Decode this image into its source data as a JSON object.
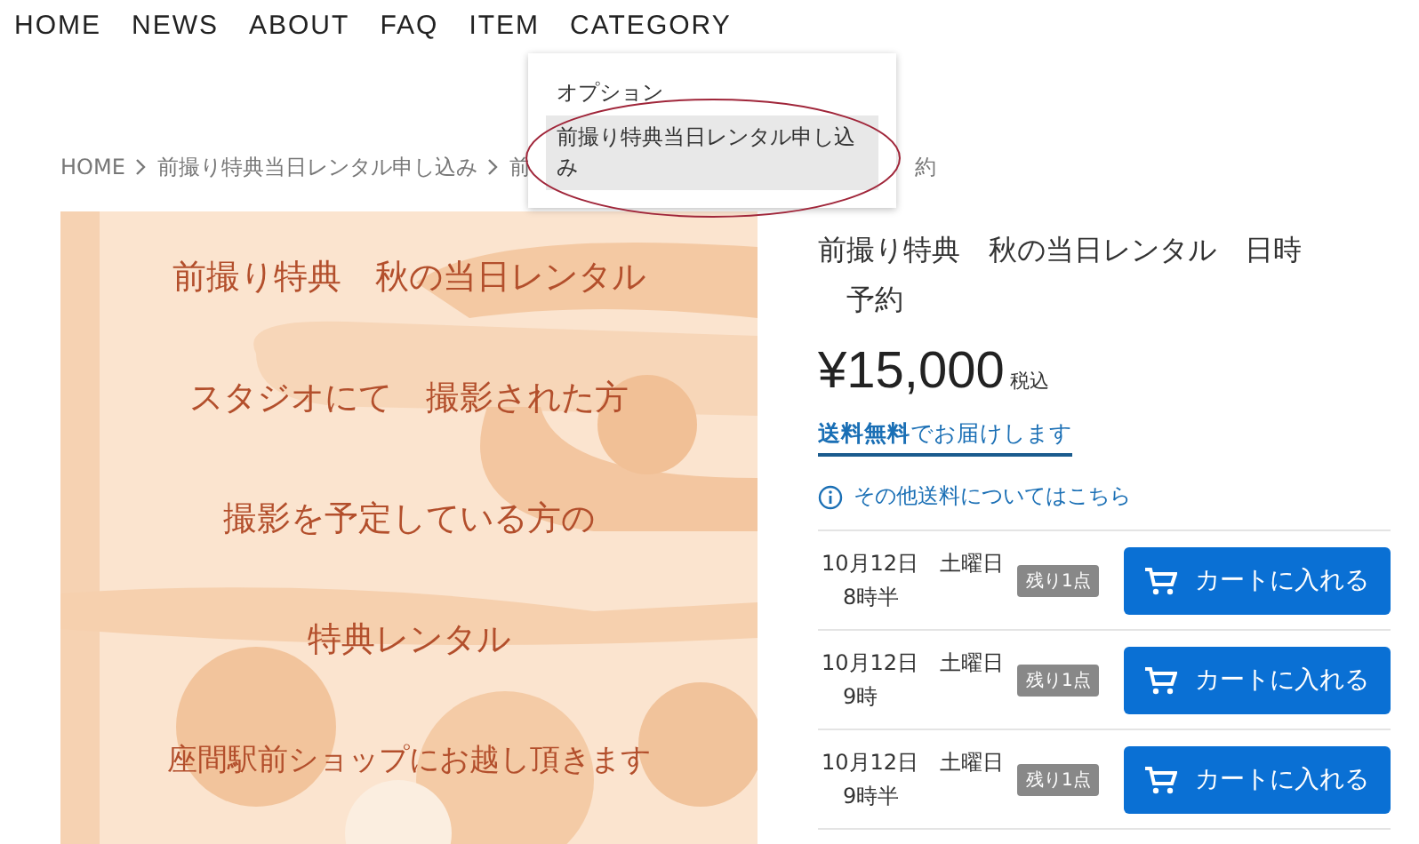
{
  "nav": [
    {
      "label": "HOME"
    },
    {
      "label": "NEWS"
    },
    {
      "label": "ABOUT"
    },
    {
      "label": "FAQ"
    },
    {
      "label": "ITEM"
    },
    {
      "label": "CATEGORY"
    }
  ],
  "dropdown": {
    "items": [
      {
        "label": "オプション",
        "selected": false
      },
      {
        "label": "前撮り特典当日レンタル申し込み",
        "selected": true
      }
    ]
  },
  "breadcrumb": [
    "HOME",
    "前撮り特典当日レンタル申し込み",
    "前"
  ],
  "breadcrumb_tail": "約",
  "banner": {
    "lines": [
      "前撮り特典　秋の当日レンタル",
      "スタジオにて　撮影された方",
      "撮影を予定している方の",
      "特典レンタル",
      "座間駅前ショップにお越し頂きます"
    ]
  },
  "product": {
    "title_lines": [
      "前撮り特典　秋の当日レンタル　日時",
      "予約"
    ],
    "price": "¥15,000",
    "tax": "税込",
    "shipping": "**送料無料**でお届けします",
    "shipping_info": "その他送料についてはこちら",
    "slots": [
      {
        "date": "10月12日　土曜日",
        "time": "8時半",
        "badge": "残り1点",
        "button": "カートに入れる"
      },
      {
        "date": "10月12日　土曜日",
        "time": "9時",
        "badge": "残り1点",
        "button": "カートに入れる"
      },
      {
        "date": "10月12日　土曜日",
        "time": "9時半",
        "badge": "残り1点",
        "button": "カートに入れる"
      }
    ]
  }
}
